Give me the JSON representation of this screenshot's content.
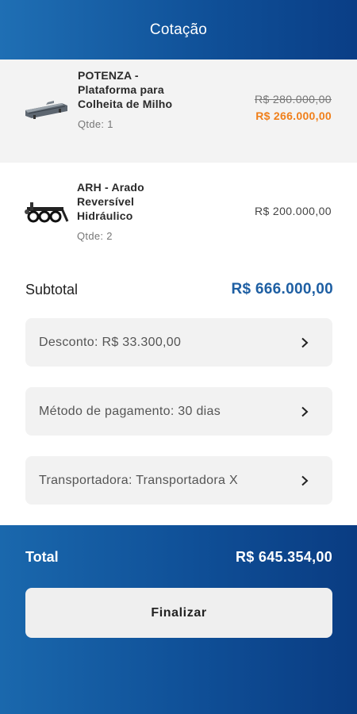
{
  "header": {
    "title": "Cotação"
  },
  "items": [
    {
      "icon": "harvest-platform-image",
      "name": "POTENZA - Plataforma para Colheita de Milho",
      "qty": "Qtde: 1",
      "old_price": "R$ 280.000,00",
      "new_price": "R$ 266.000,00"
    },
    {
      "icon": "plow-image",
      "name": "ARH - Arado Reversível Hidráulico",
      "qty": "Qtde: 2",
      "price": "R$ 200.000,00"
    }
  ],
  "subtotal": {
    "label": "Subtotal",
    "value": "R$ 666.000,00"
  },
  "options": [
    {
      "label": "Desconto: R$ 33.300,00",
      "icon": "chevron-right-icon"
    },
    {
      "label": "Método de pagamento: 30 dias",
      "icon": "chevron-right-icon"
    },
    {
      "label": "Transportadora: Transportadora X",
      "icon": "chevron-right-icon"
    }
  ],
  "total": {
    "label": "Total",
    "value": "R$ 645.354,00"
  },
  "finish_button": {
    "label": "Finalizar"
  },
  "colors": {
    "header_blue": "#0f4f97",
    "price_orange": "#f07f1a",
    "subtotal_blue": "#1e5fa3",
    "option_bg": "#f2f2f2"
  }
}
